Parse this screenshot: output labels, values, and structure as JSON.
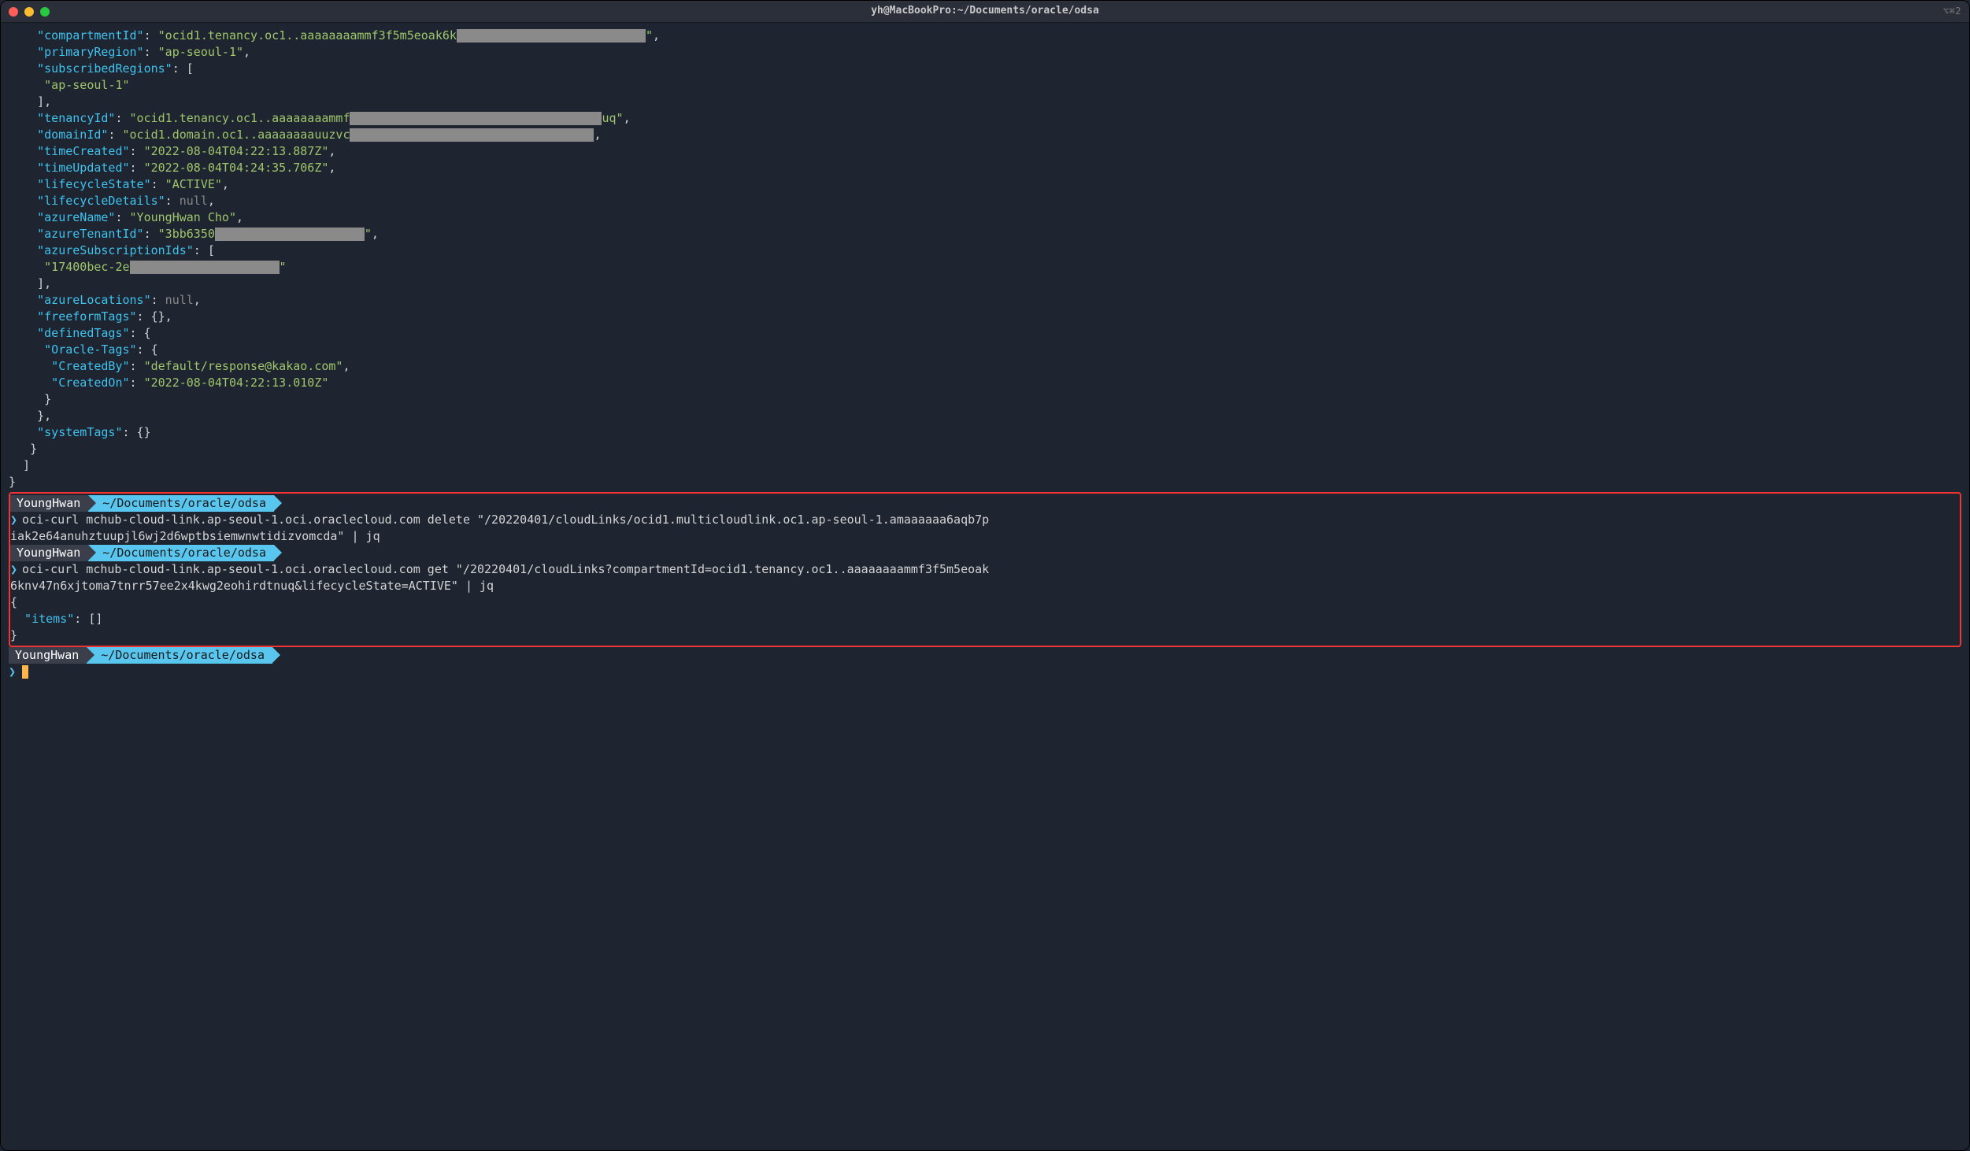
{
  "window": {
    "title": "yh@MacBookPro:~/Documents/oracle/odsa",
    "tab_indicator": "⌥⌘2"
  },
  "json_output": {
    "compartmentId_key": "\"compartmentId\"",
    "compartmentId_val_prefix": "\"ocid1.tenancy.oc1..aaaaaaaammf3f5m5eoak6k",
    "compartmentId_val_suffix": "\"",
    "primaryRegion_key": "\"primaryRegion\"",
    "primaryRegion_val": "\"ap-seoul-1\"",
    "subscribedRegions_key": "\"subscribedRegions\"",
    "subscribedRegions_item0": "\"ap-seoul-1\"",
    "tenancyId_key": "\"tenancyId\"",
    "tenancyId_val_prefix": "\"ocid1.tenancy.oc1..aaaaaaaammf",
    "tenancyId_val_suffix": "uq\"",
    "domainId_key": "\"domainId\"",
    "domainId_val_prefix": "\"ocid1.domain.oc1..aaaaaaaauuzvc",
    "timeCreated_key": "\"timeCreated\"",
    "timeCreated_val": "\"2022-08-04T04:22:13.887Z\"",
    "timeUpdated_key": "\"timeUpdated\"",
    "timeUpdated_val": "\"2022-08-04T04:24:35.706Z\"",
    "lifecycleState_key": "\"lifecycleState\"",
    "lifecycleState_val": "\"ACTIVE\"",
    "lifecycleDetails_key": "\"lifecycleDetails\"",
    "lifecycleDetails_val": "null",
    "azureName_key": "\"azureName\"",
    "azureName_val": "\"YoungHwan Cho\"",
    "azureTenantId_key": "\"azureTenantId\"",
    "azureTenantId_val_prefix": "\"3bb6350",
    "azureTenantId_val_suffix": "\"",
    "azureSubscriptionIds_key": "\"azureSubscriptionIds\"",
    "azureSubscriptionIds_item0_prefix": "\"17400bec-2e",
    "azureSubscriptionIds_item0_suffix": "\"",
    "azureLocations_key": "\"azureLocations\"",
    "azureLocations_val": "null",
    "freeformTags_key": "\"freeformTags\"",
    "freeformTags_val": "{}",
    "definedTags_key": "\"definedTags\"",
    "oracleTags_key": "\"Oracle-Tags\"",
    "createdBy_key": "\"CreatedBy\"",
    "createdBy_val": "\"default/response@kakao.com\"",
    "createdOn_key": "\"CreatedOn\"",
    "createdOn_val": "\"2022-08-04T04:22:13.010Z\"",
    "systemTags_key": "\"systemTags\"",
    "systemTags_val": "{}"
  },
  "prompts": {
    "user": "YoungHwan",
    "path": "~/Documents/oracle/odsa",
    "caret": "❯"
  },
  "commands": {
    "cmd1_part1": "oci-curl mchub-cloud-link.ap-seoul-1.oci.oraclecloud.com delete \"/20220401/cloudLinks/ocid1.multicloudlink.oc1.ap-seoul-1.amaaaaaa6aqb7p",
    "cmd1_part2": "iak2e64anuhztuupjl6wj2d6wptbsiemwnwtidizvomcda\" | jq",
    "cmd2_part1": "oci-curl mchub-cloud-link.ap-seoul-1.oci.oraclecloud.com get \"/20220401/cloudLinks?compartmentId=ocid1.tenancy.oc1..aaaaaaaammf3f5m5eoak",
    "cmd2_part2": "6knv47n6xjtoma7tnrr57ee2x4kwg2eohirdtnuq&lifecycleState=ACTIVE\" | jq"
  },
  "response": {
    "open": "{",
    "items_key": "\"items\"",
    "items_val": "[]",
    "close": "}"
  }
}
